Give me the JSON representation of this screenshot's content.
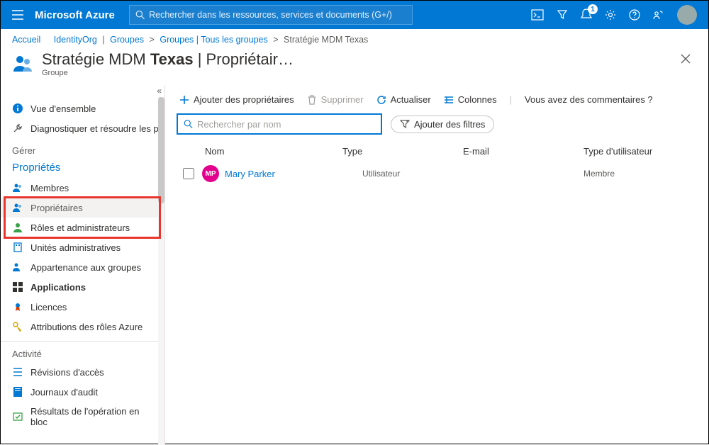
{
  "topbar": {
    "brand": "Microsoft Azure",
    "search_placeholder": "Rechercher dans les ressources, services et documents (G+/)",
    "notification_count": "1"
  },
  "breadcrumb": {
    "home": "Accueil",
    "org": "IdentityOrg",
    "groups": "Groupes",
    "groups2": "Groupes | Tous les groupes",
    "current": "Stratégie MDM Texas"
  },
  "page": {
    "title_prefix": "Stratégie MDM ",
    "title_bold": "Texas",
    "title_suffix": " | Propriétair…",
    "subtitle": "Groupe"
  },
  "sidebar": {
    "overview": "Vue d'ensemble",
    "diagnose": "Diagnostiquer et résoudre les problèmes",
    "section_manage": "Gérer",
    "properties": "Propriétés",
    "members": "Membres",
    "owners": "Propriétaires",
    "roles": "Rôles et administrateurs",
    "admin_units": "Unités administratives",
    "group_membership": "Appartenance aux groupes",
    "applications": "Applications",
    "licenses": "Licences",
    "azure_roles": "Attributions des rôles Azure",
    "section_activity": "Activité",
    "access_reviews": "Révisions d'accès",
    "audit_logs": "Journaux d'audit",
    "bulk_results": "Résultats de l'opération en bloc"
  },
  "toolbar": {
    "add_owners": "Ajouter des propriétaires",
    "remove": "Supprimer",
    "refresh": "Actualiser",
    "columns": "Colonnes",
    "feedback": "Vous avez des commentaires ?"
  },
  "filters": {
    "search_placeholder": "Rechercher par nom",
    "add_filters": "Ajouter des filtres"
  },
  "table": {
    "headers": {
      "name": "Nom",
      "type": "Type",
      "email": "E-mail",
      "user_type": "Type d'utilisateur"
    },
    "rows": [
      {
        "initials": "MP",
        "name": "Mary Parker",
        "type": "Utilisateur",
        "email": "",
        "user_type": "Membre"
      }
    ]
  }
}
